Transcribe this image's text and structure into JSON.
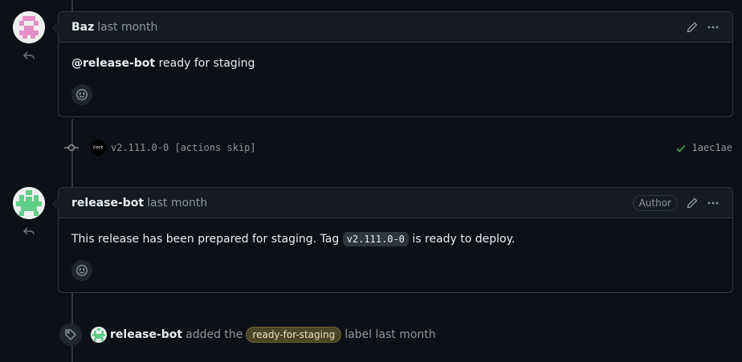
{
  "comments": [
    {
      "author": "Baz",
      "timestamp": "last month",
      "mention": "@release-bot",
      "body_text": " ready for staging",
      "avatar_icon": "identicon-pink"
    },
    {
      "author": "release-bot",
      "timestamp": "last month",
      "badge": "Author",
      "body_before": "This release has been prepared for staging. Tag ",
      "body_code": "v2.111.0-0",
      "body_after": " is ready to deploy.",
      "avatar_icon": "identicon-green"
    }
  ],
  "commit": {
    "avatar_text": "clock",
    "message": "v2.111.0-0 [actions skip]",
    "status_icon": "check-icon",
    "sha": "1aec1ae"
  },
  "label_event": {
    "actor": "release-bot",
    "action": "added the",
    "label": "ready-for-staging",
    "suffix": "label last month"
  },
  "colors": {
    "background": "#0d1117",
    "header_bg": "#161b22",
    "border": "#30363d",
    "success": "#3fb950",
    "label_bg": "#4a4524"
  }
}
